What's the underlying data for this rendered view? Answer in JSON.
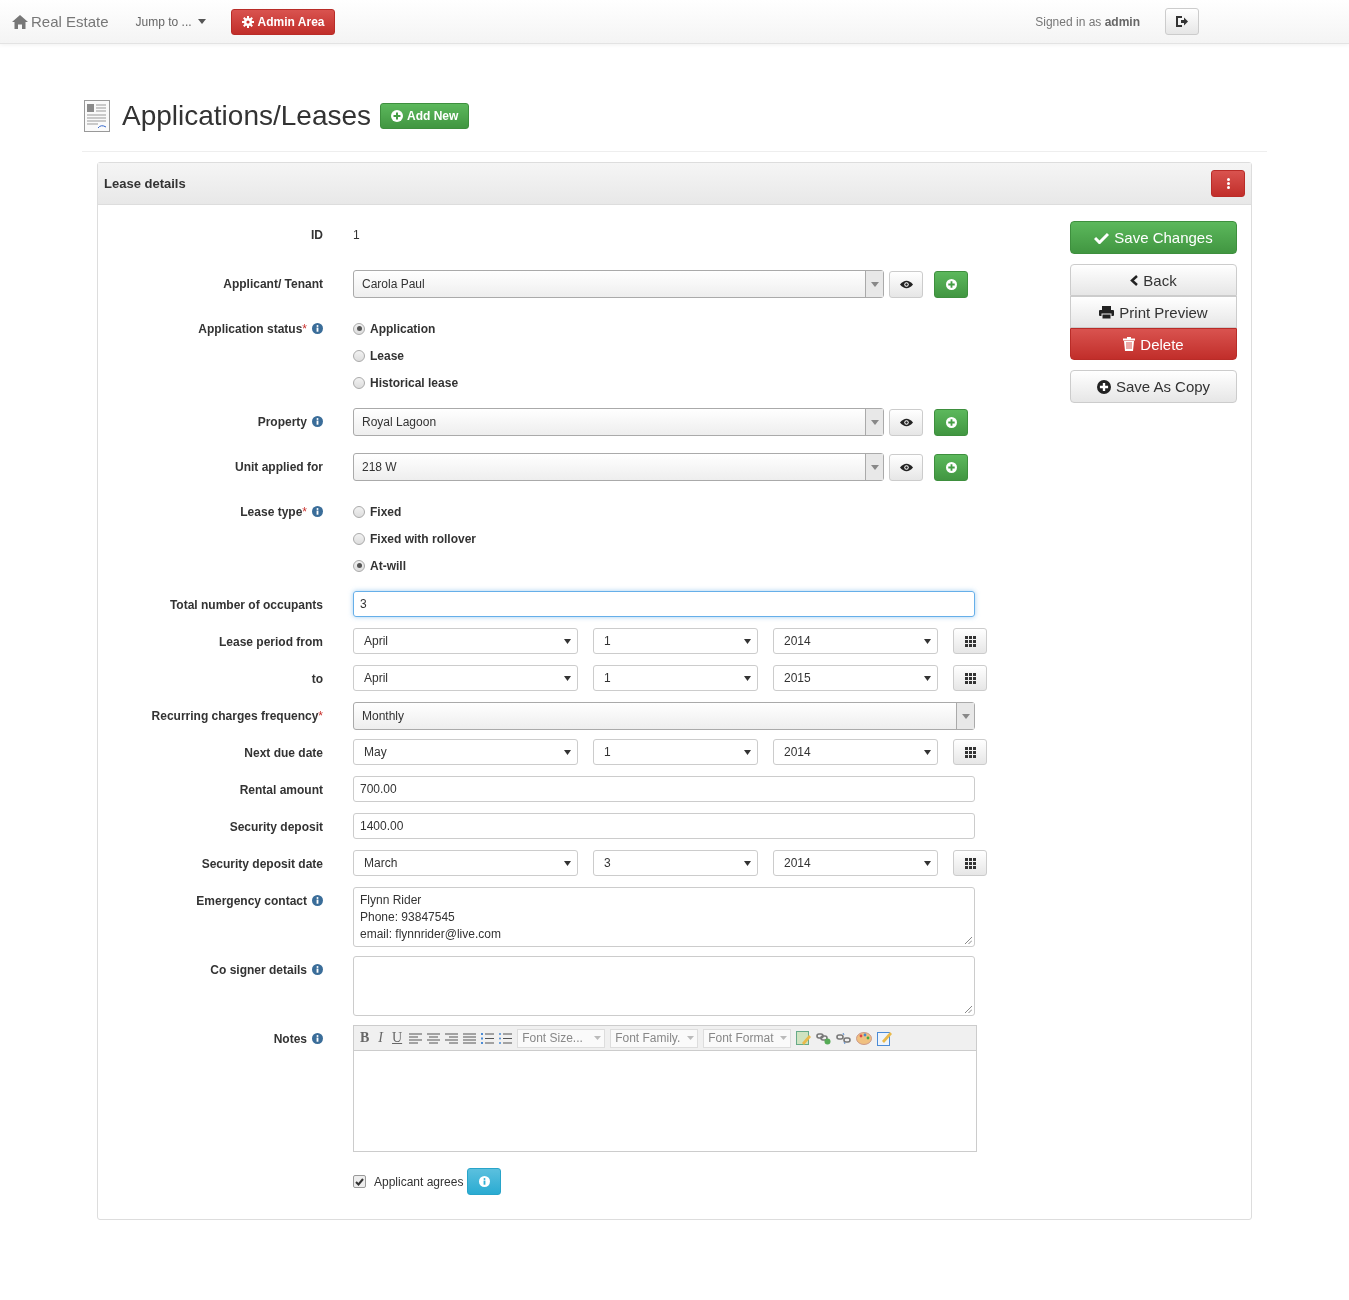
{
  "navbar": {
    "brand": "Real Estate",
    "jump": "Jump to ...",
    "admin": "Admin Area",
    "signed_in": "Signed in as",
    "user": "admin"
  },
  "page": {
    "title": "Applications/Leases",
    "add_button": "Add New"
  },
  "panel": {
    "title": "Lease details"
  },
  "fields": [
    {
      "kind": "static",
      "label": "ID",
      "value": "1"
    },
    {
      "kind": "lookup",
      "label": "Applicant/ Tenant",
      "value": "Carola Paul"
    },
    {
      "kind": "radios",
      "label": "Application status",
      "required": "*",
      "info": true,
      "options": [
        {
          "label": "Application",
          "selected": true
        },
        {
          "label": "Lease",
          "selected": false
        },
        {
          "label": "Historical lease",
          "selected": false
        }
      ]
    },
    {
      "kind": "lookup",
      "label": "Property",
      "info": true,
      "value": "Royal Lagoon"
    },
    {
      "kind": "lookup",
      "label": "Unit applied for",
      "value": "218 W"
    },
    {
      "kind": "radios",
      "label": "Lease type",
      "required": "*",
      "info": true,
      "options": [
        {
          "label": "Fixed",
          "selected": false
        },
        {
          "label": "Fixed with rollover",
          "selected": false
        },
        {
          "label": "At-will",
          "selected": true
        }
      ]
    },
    {
      "kind": "text",
      "label": "Total number of occupants",
      "value": "3",
      "focused": true
    },
    {
      "kind": "date",
      "label": "Lease period from",
      "month": "April",
      "day": "1",
      "year": "2014"
    },
    {
      "kind": "date",
      "label": "to",
      "month": "April",
      "day": "1",
      "year": "2015"
    },
    {
      "kind": "select",
      "label": "Recurring charges frequency",
      "required": "*",
      "value": "Monthly"
    },
    {
      "kind": "date",
      "label": "Next due date",
      "month": "May",
      "day": "1",
      "year": "2014"
    },
    {
      "kind": "text",
      "label": "Rental amount",
      "value": "700.00",
      "focused": false
    },
    {
      "kind": "text",
      "label": "Security deposit",
      "value": "1400.00",
      "focused": false
    },
    {
      "kind": "date",
      "label": "Security deposit date",
      "month": "March",
      "day": "3",
      "year": "2014"
    },
    {
      "kind": "textarea",
      "label": "Emergency contact",
      "info": true,
      "lines": [
        "Flynn Rider",
        "Phone: 93847545",
        "email: flynnrider@live.com"
      ]
    },
    {
      "kind": "textarea",
      "label": "Co signer details",
      "info": true
    },
    {
      "kind": "editor",
      "label": "Notes",
      "info": true,
      "format_buttons": [
        "B",
        "I",
        "U"
      ],
      "dropdowns": [
        "Font Size...",
        "Font Family.",
        "Font Format"
      ]
    },
    {
      "kind": "checkbox",
      "label": "Applicant agrees",
      "checked": true
    }
  ],
  "actions": {
    "save": "Save Changes",
    "back": "Back",
    "print": "Print Preview",
    "delete": "Delete",
    "copy": "Save As Copy"
  }
}
